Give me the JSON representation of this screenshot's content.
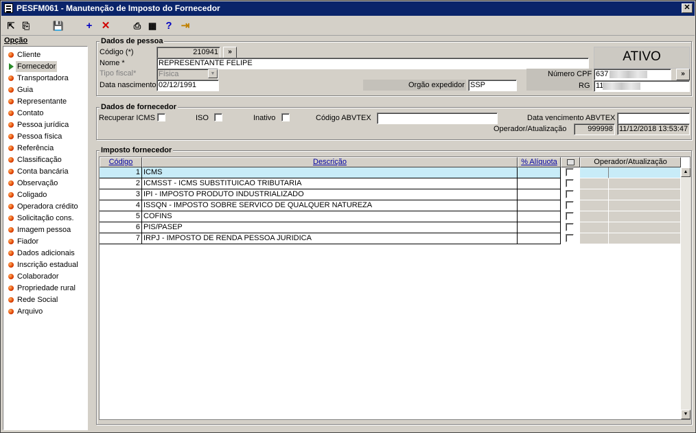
{
  "window": {
    "title": "PESFM061 - Manutenção de Imposto do Fornecedor",
    "close_glyph": "✕"
  },
  "toolbar": {
    "items": [
      {
        "name": "copy-icon",
        "glyph": "⇱"
      },
      {
        "name": "paste-icon",
        "glyph": "⎘"
      },
      {
        "name": "save-icon",
        "glyph": "💾"
      },
      {
        "name": "add-icon",
        "glyph": "+"
      },
      {
        "name": "delete-icon",
        "glyph": "✕"
      },
      {
        "name": "print-icon",
        "glyph": "⎙"
      },
      {
        "name": "calculator-icon",
        "glyph": "▦"
      },
      {
        "name": "help-icon",
        "glyph": "?"
      },
      {
        "name": "exit-icon",
        "glyph": "⇥"
      }
    ]
  },
  "options": {
    "label": "Opção",
    "items": [
      "Cliente",
      "Fornecedor",
      "Transportadora",
      "Guia",
      "Representante",
      "Contato",
      "Pessoa jurídica",
      "Pessoa física",
      "Referência",
      "Classificação",
      "Conta bancária",
      "Observação",
      "Coligado",
      "Operadora crédito",
      "Solicitação cons.",
      "Imagem pessoa",
      "Fiador",
      "Dados adicionais",
      "Inscrição estadual",
      "Colaborador",
      "Propriedade rural",
      "Rede Social",
      "Arquivo"
    ],
    "selected": "Fornecedor"
  },
  "pessoa": {
    "title": "Dados de pessoa",
    "codigo_label": "Código (*)",
    "codigo_value": "210941",
    "lookup_glyph": "»",
    "nome_label": "Nome *",
    "nome_value": "REPRESENTANTE FELIPE",
    "tipo_label": "Tipo fiscal*",
    "tipo_value": "Física",
    "nasc_label": "Data nascimento",
    "nasc_value": "02/12/1991",
    "orgao_label": "Orgão expedidor",
    "orgao_value": "SSP",
    "status": "ATIVO",
    "cpf_label": "Número CPF",
    "cpf_value": "637",
    "rg_label": "RG",
    "rg_value": "11"
  },
  "fornecedor": {
    "title": "Dados de fornecedor",
    "recuperar_label": "Recuperar ICMS",
    "iso_label": "ISO",
    "inativo_label": "Inativo",
    "abvtex_label": "Código ABVTEX",
    "abvtex_value": "",
    "venc_label": "Data vencimento ABVTEX",
    "venc_value": "",
    "oper_label": "Operador/Atualização",
    "oper_code": "999998",
    "oper_date": "11/12/2018 13:53:47"
  },
  "imposto": {
    "title": "Imposto fornecedor",
    "columns": [
      "Código",
      "Descrição",
      "% Alíquota",
      "",
      "Operador/Atualização"
    ],
    "rows": [
      {
        "codigo": "1",
        "descricao": "ICMS"
      },
      {
        "codigo": "2",
        "descricao": "ICMSST - ICMS SUBSTITUICAO TRIBUTARIA"
      },
      {
        "codigo": "3",
        "descricao": "IPI - IMPOSTO PRODUTO INDUSTRIALIZADO"
      },
      {
        "codigo": "4",
        "descricao": "ISSQN - IMPOSTO SOBRE SERVICO DE QUALQUER NATUREZA"
      },
      {
        "codigo": "5",
        "descricao": "COFINS"
      },
      {
        "codigo": "6",
        "descricao": "PIS/PASEP"
      },
      {
        "codigo": "7",
        "descricao": "IRPJ - IMPOSTO DE RENDA PESSOA JURIDICA"
      }
    ],
    "selected_row": 0
  },
  "colors": {
    "title_bar": "#0a246a",
    "selected_row": "#c8ecf8",
    "face": "#d4d0c8"
  }
}
